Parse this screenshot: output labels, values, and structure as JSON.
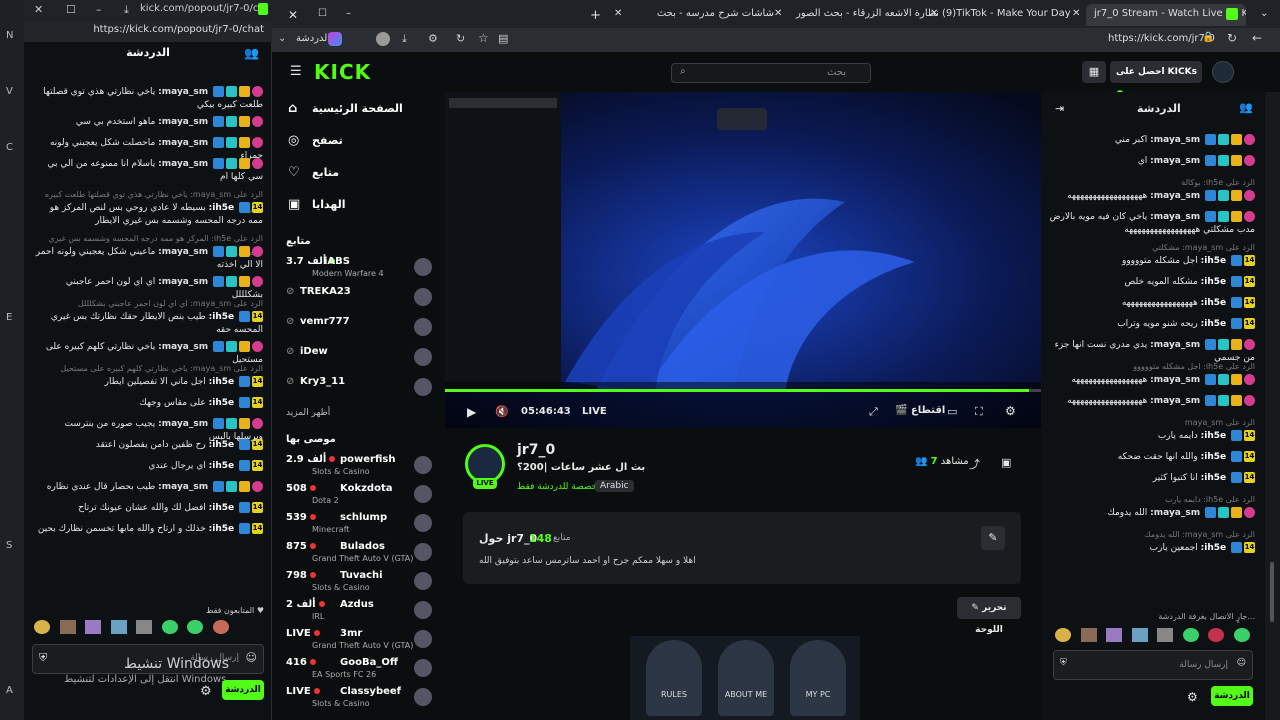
{
  "left_strip": {
    "letters": [
      "N",
      "V",
      "C",
      "E",
      "S",
      "A"
    ]
  },
  "popout": {
    "url": "https://kick.com/popout/jr7-0/chat",
    "tab_title": "kick.com/popout/jr7-0/ch...",
    "header": "الدردشة",
    "messages": [
      {
        "user": "maya_sm:",
        "text": "ياخي نظارتي هذي توي قصلتها طلعت كبيره بيكي"
      },
      {
        "user": "maya_sm:",
        "text": "ماهو استخدم بي سي"
      },
      {
        "user": "maya_sm:",
        "text": "ماحصلت شكل يعجبني ولونه حمراء"
      },
      {
        "user": "maya_sm:",
        "text": "ياسلام انا ممنوعه من الي بي سي كلها ام"
      },
      {
        "reply": "الرد على maya_sm: ياخي نظارتي هذي توي قصلتها طلعت كبيره بيكي"
      },
      {
        "user": "ih5e:",
        "text": "بسيطه لا عادي روحي بس لنص المركز هو ممه درجه المحسه وشسمه بس غيري الايطار"
      },
      {
        "reply": "الرد على ih5e: المركز هو ممه درجه المحسه وشسمه بس غيري الايطار..."
      },
      {
        "user": "maya_sm:",
        "text": "ماعيني شكل يعجبني ولونه احمر الا الي اخذته"
      },
      {
        "user": "maya_sm:",
        "text": "اي اي لون احمر عاجبني بشكلللل"
      },
      {
        "reply": "الرد على maya_sm: اي اي لون احمر عاجبني بشكلللل"
      },
      {
        "user": "ih5e:",
        "text": "طيب بنص الايطار حقك نظارتك بس غيري المحسه حقه"
      },
      {
        "user": "maya_sm:",
        "text": "ياخي نظارتي كلهم كبيره على مستحيل"
      },
      {
        "reply": "الرد على maya_sm: ياخي نظارتي كلهم كبيره على مستحيل"
      },
      {
        "user": "ih5e:",
        "text": "اجل ماني الا تفصيلين ايطار"
      },
      {
        "user": "ih5e:",
        "text": "على مقاس وجهك"
      },
      {
        "user": "maya_sm:",
        "text": "يجيب صوره من بنترست وبرسلها بالبس"
      },
      {
        "user": "ih5e:",
        "text": "رح ظفين دامن يفصلون اعتقد"
      },
      {
        "user": "ih5e:",
        "text": "اي يرجال عندي"
      },
      {
        "user": "maya_sm:",
        "text": "طيب بحصار قال عندي نظاره"
      },
      {
        "user": "ih5e:",
        "text": "افضل لك والله عشان عيونك ترتاح"
      },
      {
        "user": "ih5e:",
        "text": "خذلك و ارتاح والله مابها تخسمن نظارك بحين"
      }
    ],
    "followers_only": "المتابعون فقط",
    "input_placeholder": "إرسال رسالة",
    "chat_button": "الدردشة",
    "watermark_title": "تنشيط Windows",
    "watermark_sub": "انتقل إلى الإعدادات لتنشيط Windows."
  },
  "browser": {
    "tabs": [
      {
        "label": "jr7_0 Stream - Watch Live on Kick",
        "active": true
      },
      {
        "label": "(9)TikTok - Make Your Day"
      },
      {
        "label": "نظارة الاشعه الزرقاء - بحث الصور"
      },
      {
        "label": "شاشات شرح مدرسه - بحث"
      }
    ],
    "url": "https://kick.com/jr7-0",
    "bookmark": "الدردشة"
  },
  "kick": {
    "logo": "KICK",
    "search_placeholder": "بحث",
    "get_kicks": "احصل على KICKs",
    "nav": [
      {
        "label": "الصفحة الرئيسية",
        "icon": "⌂"
      },
      {
        "label": "تصفح",
        "icon": "◎"
      },
      {
        "label": "متابع",
        "icon": "♡"
      },
      {
        "label": "الهدايا",
        "icon": "🎁"
      }
    ],
    "following_title": "متابع",
    "following": [
      {
        "name": "iABS",
        "viewers": "3.7 ألف",
        "game": "Modern Warfare 4",
        "live": true
      },
      {
        "name": "TREKA23",
        "live": false
      },
      {
        "name": "vemr777",
        "live": false
      },
      {
        "name": "iDew",
        "live": false
      },
      {
        "name": "Kry3_11",
        "live": false
      }
    ],
    "show_more": "أظهر المزيد",
    "recommended_title": "موصى بها",
    "recommended": [
      {
        "name": "powerfish",
        "viewers": "2.9 ألف",
        "game": "Slots & Casino"
      },
      {
        "name": "Kokzdota",
        "viewers": "508",
        "game": "Dota 2"
      },
      {
        "name": "schlump",
        "viewers": "539",
        "game": "Minecraft"
      },
      {
        "name": "Bulados",
        "viewers": "875",
        "game": "Grand Theft Auto V (GTA)"
      },
      {
        "name": "Tuvachi",
        "viewers": "798",
        "game": "Slots & Casino"
      },
      {
        "name": "Azdus",
        "viewers": "2 ألف",
        "game": "IRL"
      },
      {
        "name": "3mr",
        "viewers": "LIVE",
        "game": "Grand Theft Auto V (GTA)"
      },
      {
        "name": "GooBa_Off",
        "viewers": "416",
        "game": "EA Sports FC 26"
      },
      {
        "name": "Classybeef",
        "viewers": "LIVE",
        "game": "Slots & Casino"
      }
    ],
    "player": {
      "time": "05:46:43",
      "live": "LIVE",
      "clip": "اقتطاع",
      "progress": 0.98
    },
    "streamer": {
      "name": "jr7_0",
      "title": "بث ال عشر ساعات |200؟",
      "category": "مخصصة للدردشة فقط",
      "tag": "Arabic",
      "viewers_label": "مشاهد",
      "viewers": "7",
      "live_badge": "LIVE"
    },
    "about": {
      "title": "حول jr7_0",
      "followers": "148",
      "followers_label": "متابع",
      "bio": "اهلا و سهلا ممكم جرح او احمد ساترمس ساعد بتوفيق الله"
    },
    "edit_panels": "تحرير اللوحة",
    "panels": [
      "RULES",
      "ABOUT ME",
      "MY PC"
    ]
  },
  "right_chat": {
    "header": "الدردشة",
    "messages": [
      {
        "user": "maya_sm:",
        "text": "اكبر مني"
      },
      {
        "user": "maya_sm:",
        "text": "اي"
      },
      {
        "reply": "الرد على ih5e: بوكالة"
      },
      {
        "user": "maya_sm:",
        "text": "ههههههههههههههههههه"
      },
      {
        "user": "maya_sm:",
        "text": "ياخي كان فيه مويه بالارض مدب مشكلتي هههههههههههههههههه"
      },
      {
        "reply": "الرد على maya_sm: مشكلتي"
      },
      {
        "user": "ih5e:",
        "text": "اجل مشكله متووووو"
      },
      {
        "user": "ih5e:",
        "text": "مشكله المويه خلص"
      },
      {
        "user": "ih5e:",
        "text": "هههههههههههههههههه"
      },
      {
        "user": "ih5e:",
        "text": "ريحه شنو مويه وتراب"
      },
      {
        "user": "maya_sm:",
        "text": "يدي مدري نست انها جزء من جسمي"
      },
      {
        "reply": "الرد على ih5e: اجل مشكله متووووو"
      },
      {
        "user": "maya_sm:",
        "text": "هههههههههههههههههه"
      },
      {
        "user": "maya_sm:",
        "text": "ههههههههههههههههههه"
      },
      {
        "reply": "الرد على maya_sm"
      },
      {
        "user": "ih5e:",
        "text": "دايمه يارب"
      },
      {
        "user": "ih5e:",
        "text": "والله انها حقت ضحكه"
      },
      {
        "user": "ih5e:",
        "text": "انا كتبوا كثير"
      },
      {
        "reply": "الرد على ih5e: دايمه يارب"
      },
      {
        "user": "maya_sm:",
        "text": "الله يدومك"
      },
      {
        "reply": "الرد على maya_sm: الله يدومك"
      },
      {
        "user": "ih5e:",
        "text": "اجمعين يارب"
      }
    ],
    "connecting": "جارٍ الاتصال بغرفة الدردشة...",
    "input_placeholder": "إرسال رسالة",
    "chat_button": "الدردشة"
  }
}
